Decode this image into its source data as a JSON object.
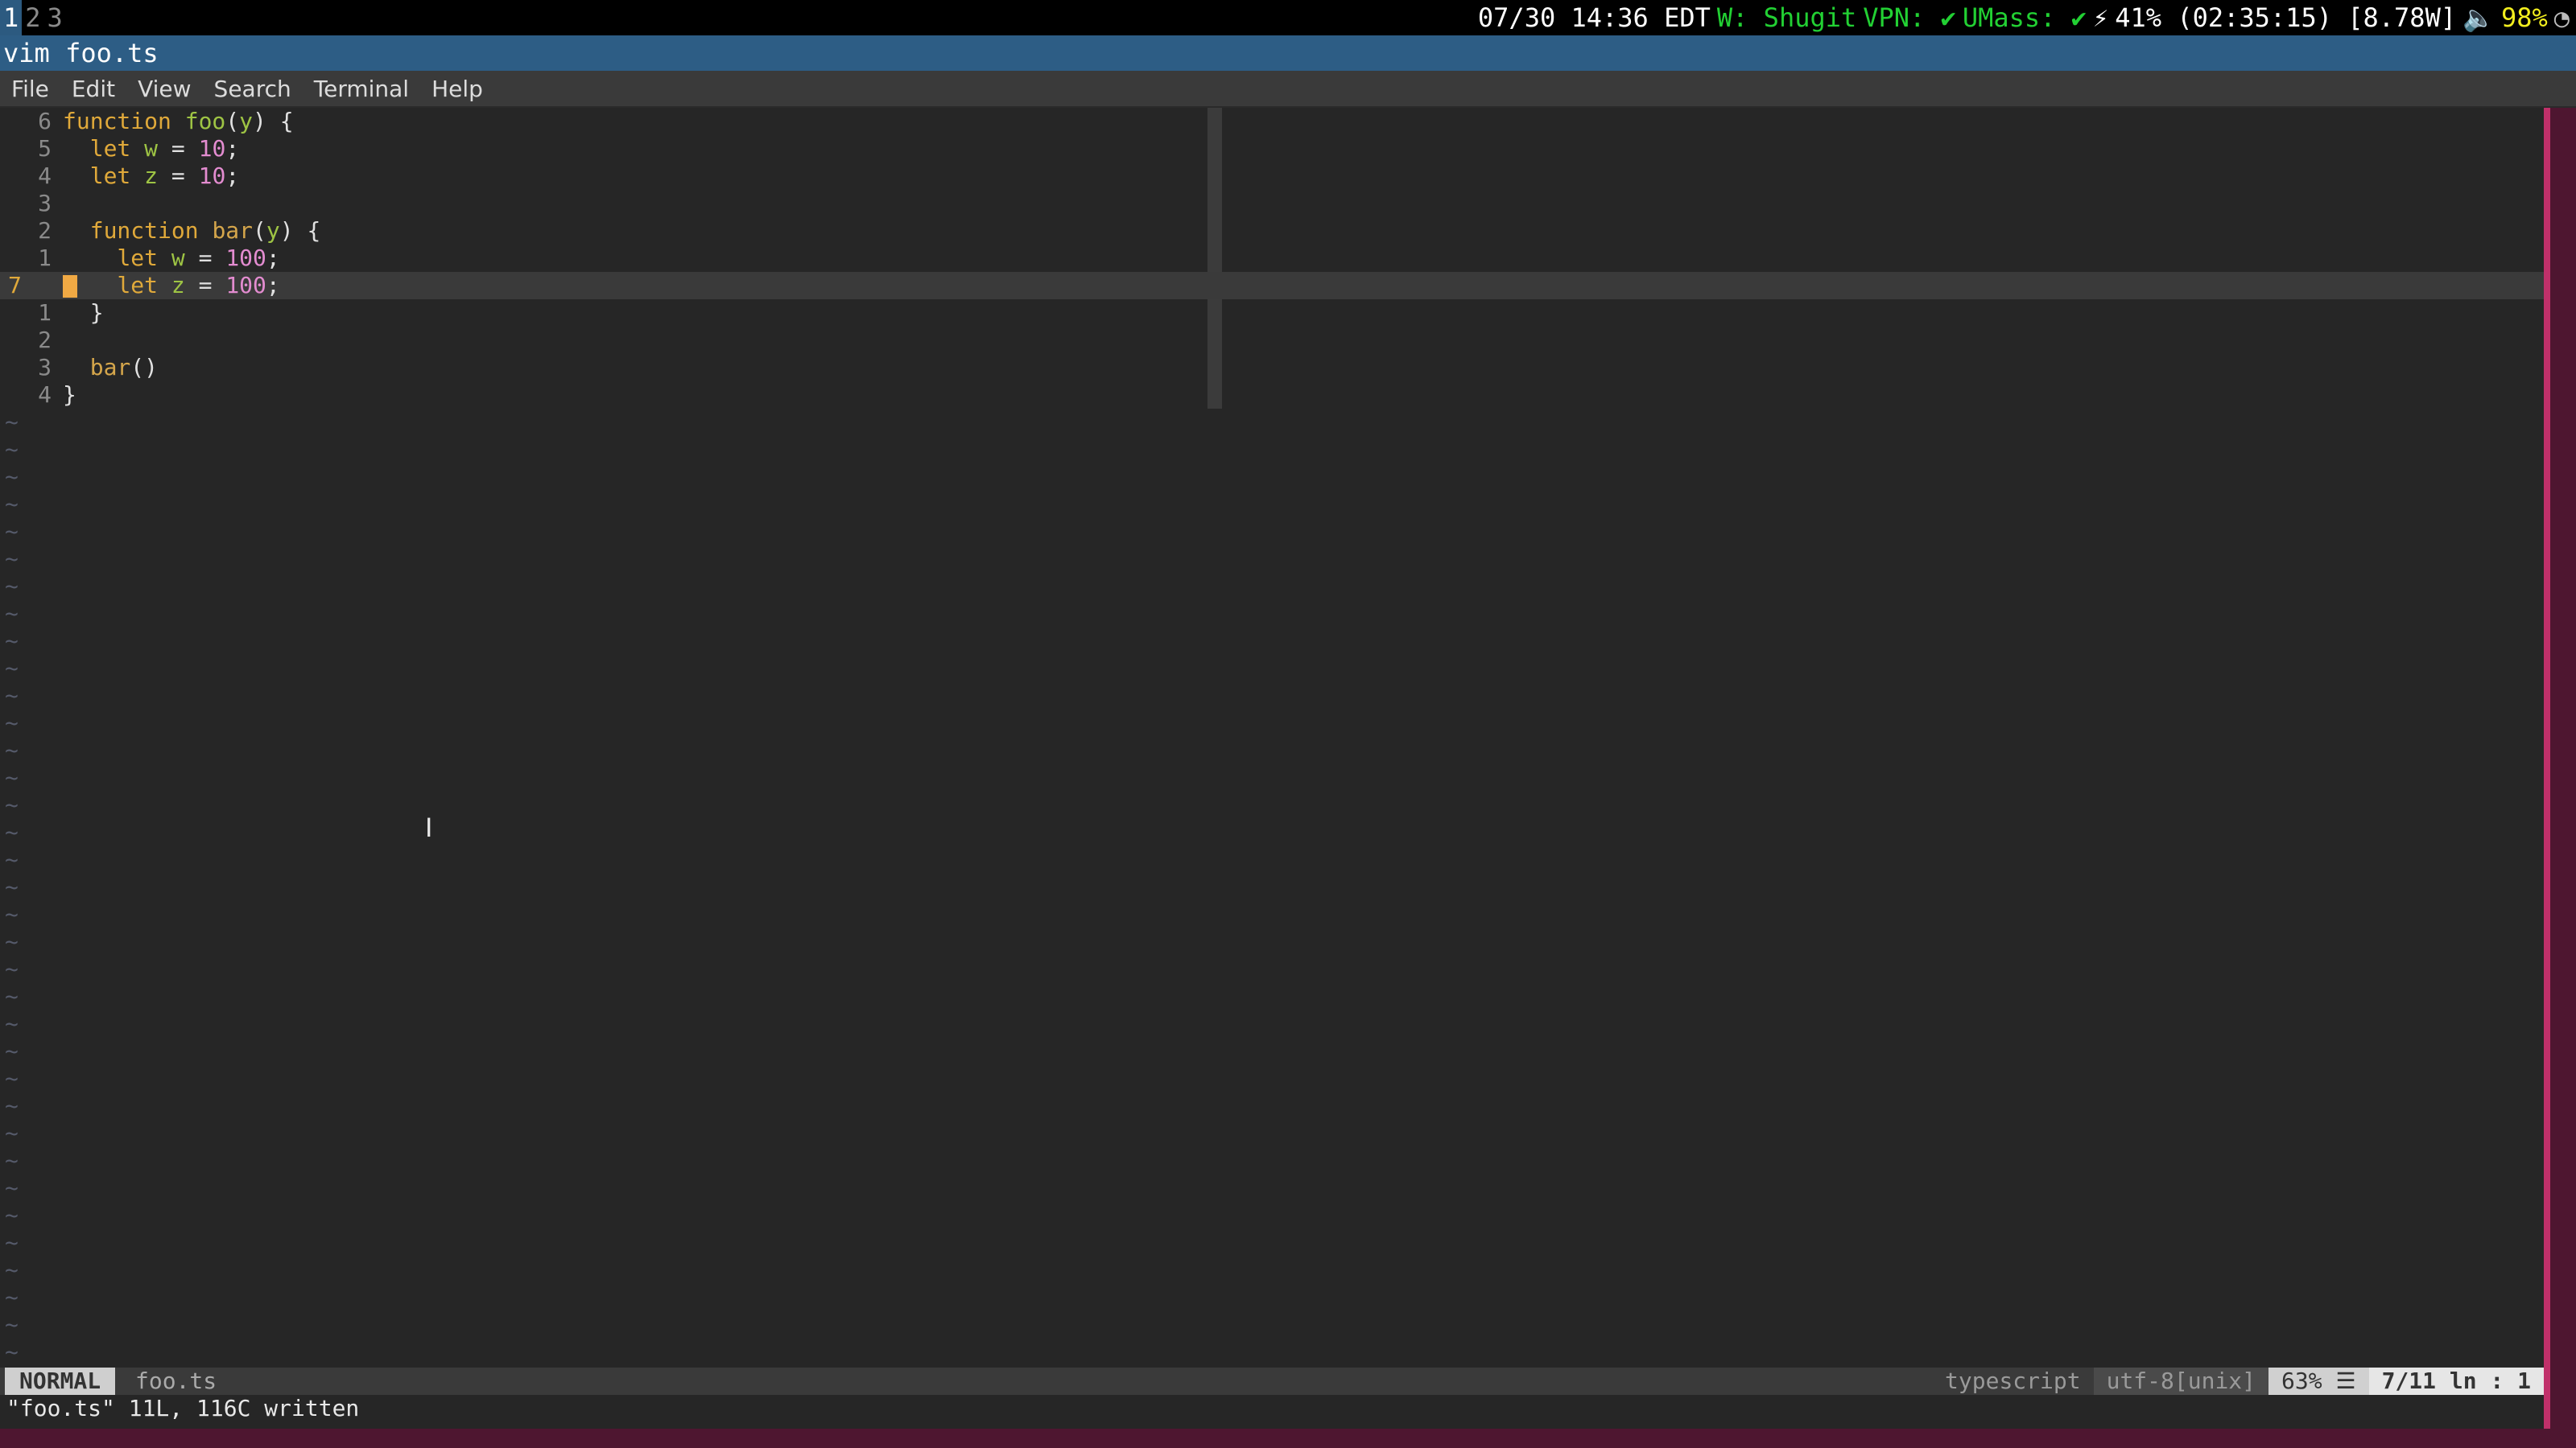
{
  "topbar": {
    "workspaces": [
      "1",
      "2",
      "3"
    ],
    "datetime": "07/30 14:36 EDT",
    "wifi": "W: Shugit",
    "vpn": "VPN: ✔",
    "umass": "UMass: ✔",
    "battery": "41% (02:35:15) [8.78W]",
    "volume": "98%"
  },
  "window_title": "vim foo.ts",
  "menu": [
    "File",
    "Edit",
    "View",
    "Search",
    "Terminal",
    "Help"
  ],
  "editor": {
    "line_numbers": [
      "6",
      "5",
      "4",
      "3",
      "2",
      "1",
      "7",
      "1",
      "2",
      "3",
      "4"
    ],
    "lines": [
      "function foo(y) {",
      "  let w = 10;",
      "  let z = 10;",
      "",
      "  function bar(y) {",
      "    let w = 100;",
      "    let z = 100;",
      "  }",
      "",
      "  bar()",
      "}"
    ],
    "current_line": "7",
    "tilde": "~"
  },
  "statusline": {
    "mode": "NORMAL",
    "filename": "foo.ts",
    "filetype": "typescript",
    "encoding": "utf-8[unix]",
    "percent": "63% ☰",
    "position": "7/11 ln : 1"
  },
  "cmdline": "\"foo.ts\" 11L, 116C written"
}
